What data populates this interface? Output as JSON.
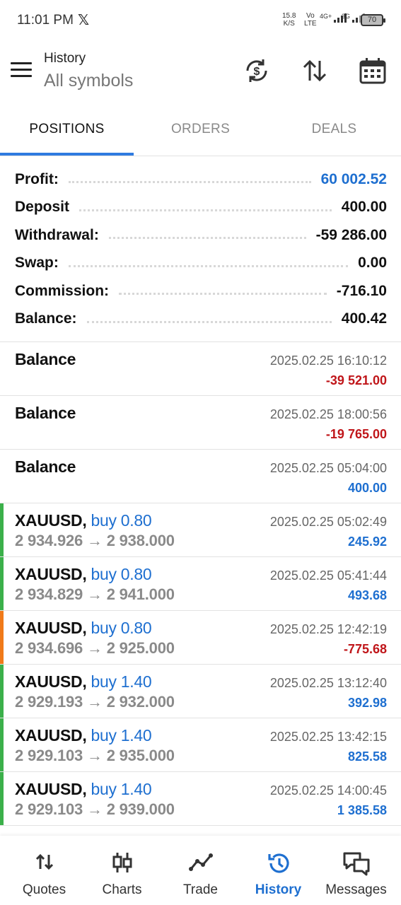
{
  "status_bar": {
    "time": "11:01 PM",
    "x_logo": "𝕏",
    "speed_value": "15.8",
    "speed_unit": "K/S",
    "volte_top": "Vo",
    "volte_bottom": "LTE",
    "net1": "4G+",
    "net2": "3G",
    "battery": "70"
  },
  "header": {
    "title": "History",
    "subtitle": "All symbols"
  },
  "tabs": [
    {
      "label": "POSITIONS",
      "active": true
    },
    {
      "label": "ORDERS",
      "active": false
    },
    {
      "label": "DEALS",
      "active": false
    }
  ],
  "summary": [
    {
      "label": "Profit:",
      "value": "60 002.52",
      "color": "#1e6fd0"
    },
    {
      "label": "Deposit",
      "value": "400.00"
    },
    {
      "label": "Withdrawal:",
      "value": "-59 286.00"
    },
    {
      "label": "Swap:",
      "value": "0.00"
    },
    {
      "label": "Commission:",
      "value": "-716.10"
    },
    {
      "label": "Balance:",
      "value": "400.42"
    }
  ],
  "rows": [
    {
      "name": "Balance",
      "side": "",
      "prices": "",
      "time": "2025.02.25 16:10:12",
      "profit": "-39 521.00",
      "positive": false,
      "accent": ""
    },
    {
      "name": "Balance",
      "side": "",
      "prices": "",
      "time": "2025.02.25 18:00:56",
      "profit": "-19 765.00",
      "positive": false,
      "accent": ""
    },
    {
      "name": "Balance",
      "side": "",
      "prices": "",
      "time": "2025.02.25 05:04:00",
      "profit": "400.00",
      "positive": true,
      "accent": ""
    },
    {
      "name": "XAUUSD,",
      "side": "buy 0.80",
      "prices": "2 934.926 → 2 938.000",
      "time": "2025.02.25 05:02:49",
      "profit": "245.92",
      "positive": true,
      "accent": "#3bb04a"
    },
    {
      "name": "XAUUSD,",
      "side": "buy 0.80",
      "prices": "2 934.829 → 2 941.000",
      "time": "2025.02.25 05:41:44",
      "profit": "493.68",
      "positive": true,
      "accent": "#3bb04a"
    },
    {
      "name": "XAUUSD,",
      "side": "buy 0.80",
      "prices": "2 934.696 → 2 925.000",
      "time": "2025.02.25 12:42:19",
      "profit": "-775.68",
      "positive": false,
      "accent": "#f07a1a"
    },
    {
      "name": "XAUUSD,",
      "side": "buy 1.40",
      "prices": "2 929.193 → 2 932.000",
      "time": "2025.02.25 13:12:40",
      "profit": "392.98",
      "positive": true,
      "accent": "#3bb04a"
    },
    {
      "name": "XAUUSD,",
      "side": "buy 1.40",
      "prices": "2 929.103 → 2 935.000",
      "time": "2025.02.25 13:42:15",
      "profit": "825.58",
      "positive": true,
      "accent": "#3bb04a"
    },
    {
      "name": "XAUUSD,",
      "side": "buy 1.40",
      "prices": "2 929.103 → 2 939.000",
      "time": "2025.02.25 14:00:45",
      "profit": "1 385.58",
      "positive": true,
      "accent": "#3bb04a"
    }
  ],
  "nav": [
    {
      "label": "Quotes",
      "icon": "quotes-icon",
      "active": false
    },
    {
      "label": "Charts",
      "icon": "charts-icon",
      "active": false
    },
    {
      "label": "Trade",
      "icon": "trade-icon",
      "active": false
    },
    {
      "label": "History",
      "icon": "history-icon",
      "active": true
    },
    {
      "label": "Messages",
      "icon": "messages-icon",
      "active": false
    }
  ],
  "colors": {
    "accent_blue": "#1e6fd0",
    "profit_positive": "#1e6fd0",
    "profit_negative": "#c0161a",
    "tab_underline": "#2f7be0"
  }
}
